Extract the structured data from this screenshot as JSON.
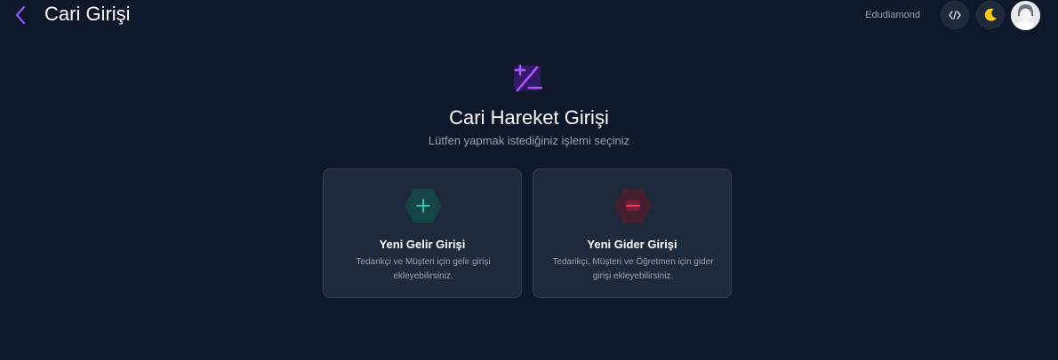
{
  "header": {
    "title": "Cari Girişi",
    "username": "Edudiamond",
    "icons": {
      "back": "chevron-left-icon",
      "code": "code-icon",
      "theme": "moon-icon",
      "avatar": "user-avatar"
    },
    "accent_color": "#8b5cf6"
  },
  "hero": {
    "icon": "plus-minus-icon",
    "title": "Cari Hareket Girişi",
    "subtitle": "Lütfen yapmak istediğiniz işlemi seçiniz"
  },
  "options": [
    {
      "icon": "plus-icon",
      "title": "Yeni Gelir Girişi",
      "description": "Tedarikçi ve Müşteri için gelir girişi ekleyebilirsiniz.",
      "color": "#14b8a6"
    },
    {
      "icon": "minus-icon",
      "title": "Yeni Gider Girişi",
      "description": "Tedarikçi, Müşteri ve Öğretmen için gider girişi ekleyebilirsiniz.",
      "color": "#e11d48"
    }
  ]
}
